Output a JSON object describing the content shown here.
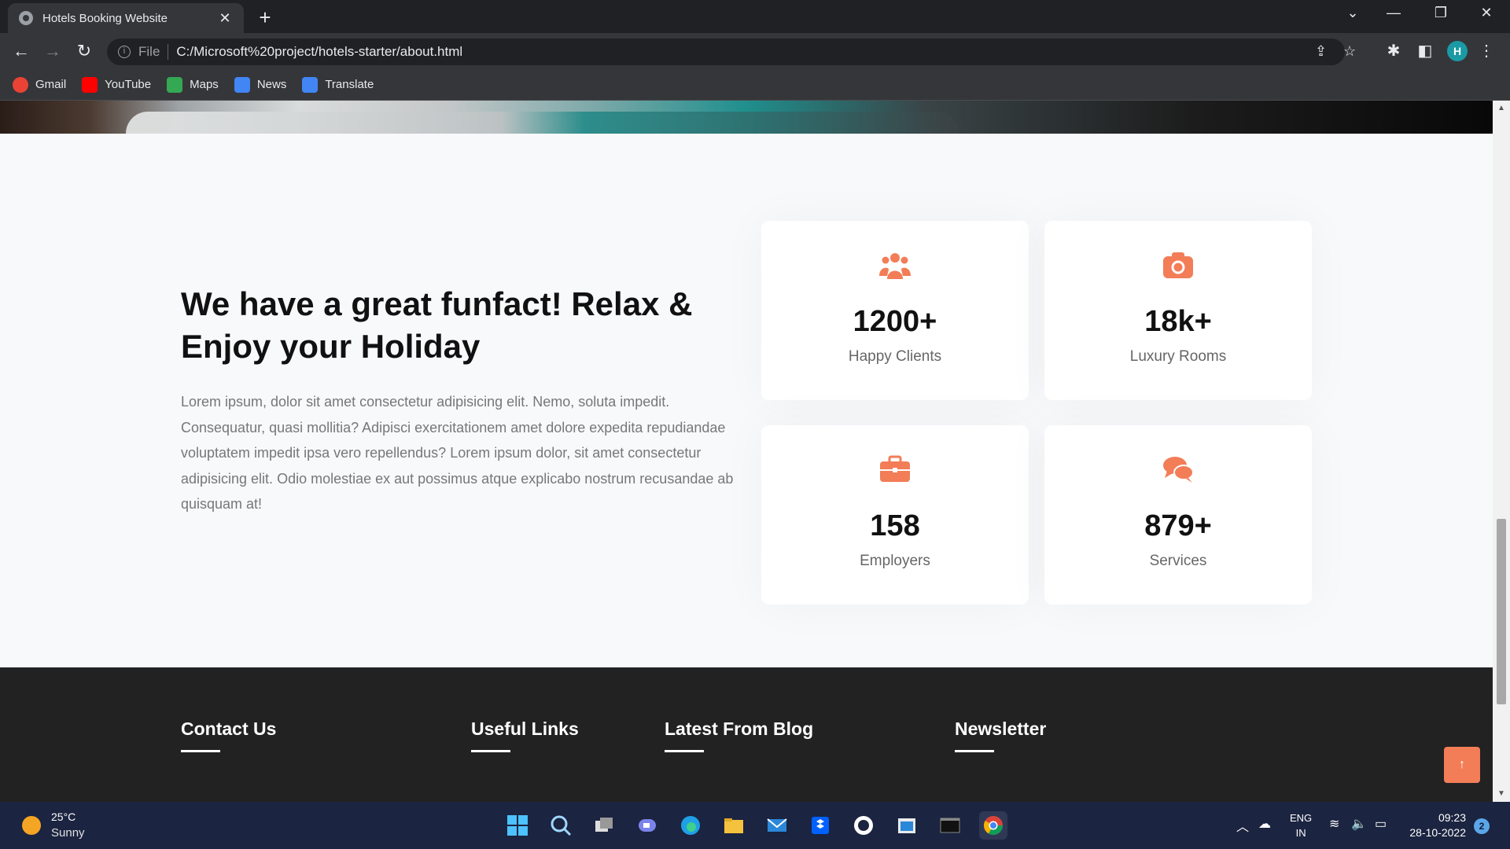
{
  "browser": {
    "tab_title": "Hotels Booking Website",
    "url_scheme": "File",
    "url": "C:/Microsoft%20project/hotels-starter/about.html",
    "profile_initial": "H",
    "bookmarks": [
      {
        "label": "Gmail",
        "icon": "gmail-icon",
        "color": "#ea4335"
      },
      {
        "label": "YouTube",
        "icon": "youtube-icon",
        "color": "#ff0000"
      },
      {
        "label": "Maps",
        "icon": "maps-icon",
        "color": "#34a853"
      },
      {
        "label": "News",
        "icon": "news-icon",
        "color": "#4285f4"
      },
      {
        "label": "Translate",
        "icon": "translate-icon",
        "color": "#4285f4"
      }
    ]
  },
  "funfact": {
    "title": "We have a great funfact! Relax & Enjoy your Holiday",
    "text": "Lorem ipsum, dolor sit amet consectetur adipisicing elit. Nemo, soluta impedit. Consequatur, quasi mollitia? Adipisci exercitationem amet dolore expedita repudiandae voluptatem impedit ipsa vero repellendus? Lorem ipsum dolor, sit amet consectetur adipisicing elit. Odio molestiae ex aut possimus atque explicabo nostrum recusandae ab quisquam at!",
    "accent_color": "#f27d57",
    "stats": [
      {
        "value": "1200+",
        "label": "Happy Clients",
        "icon": "users-icon"
      },
      {
        "value": "18k+",
        "label": "Luxury Rooms",
        "icon": "camera-icon"
      },
      {
        "value": "158",
        "label": "Employers",
        "icon": "briefcase-icon"
      },
      {
        "value": "879+",
        "label": "Services",
        "icon": "chat-icon"
      }
    ]
  },
  "footer": {
    "headings": [
      "Contact Us",
      "Useful Links",
      "Latest From Blog",
      "Newsletter"
    ]
  },
  "taskbar": {
    "temperature": "25°C",
    "weather": "Sunny",
    "lang_1": "ENG",
    "lang_2": "IN",
    "time": "09:23",
    "date": "28-10-2022",
    "notifications": "2"
  }
}
